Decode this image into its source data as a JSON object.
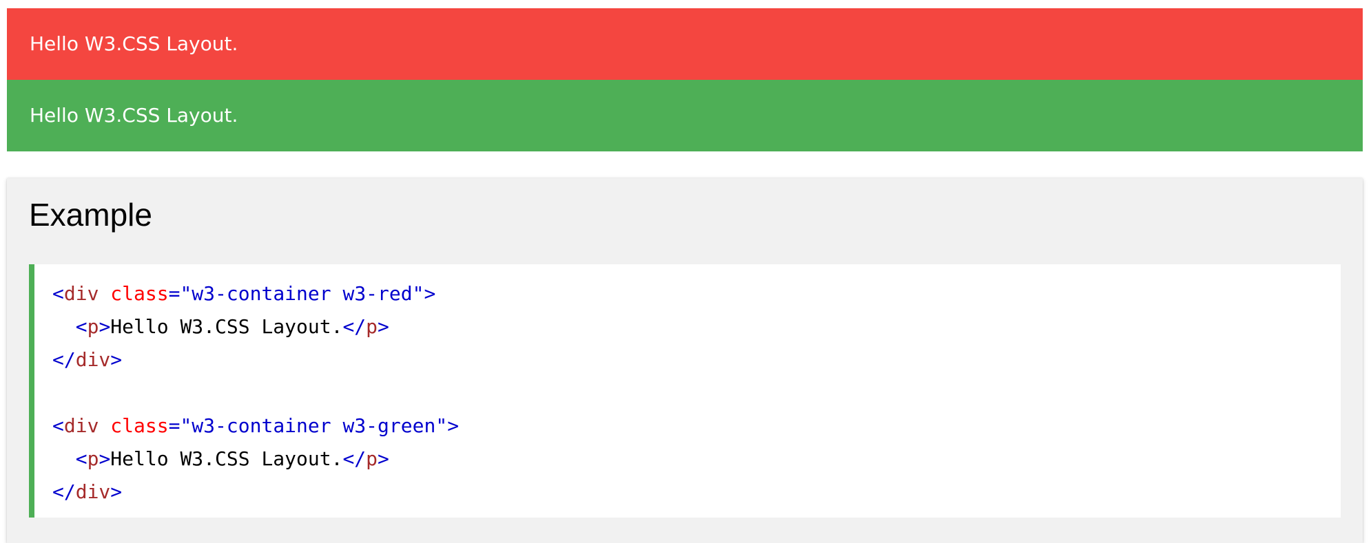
{
  "banners": {
    "red_text": "Hello W3.CSS Layout.",
    "green_text": "Hello W3.CSS Layout.",
    "red_color": "#f44640",
    "green_color": "#4eaf56"
  },
  "example": {
    "title": "Example",
    "code": {
      "line1": {
        "open": "<",
        "tag": "div",
        "space": " ",
        "attr": "class",
        "eq": "=",
        "value": "\"w3-container w3-red\"",
        "close": ">"
      },
      "line2": {
        "indent": "  ",
        "open": "<",
        "tag": "p",
        "close": ">",
        "text": "Hello W3.CSS Layout.",
        "end_open": "</",
        "end_tag": "p",
        "end_close": ">"
      },
      "line3": {
        "open": "</",
        "tag": "div",
        "close": ">"
      },
      "line5": {
        "open": "<",
        "tag": "div",
        "space": " ",
        "attr": "class",
        "eq": "=",
        "value": "\"w3-container w3-green\"",
        "close": ">"
      },
      "line6": {
        "indent": "  ",
        "open": "<",
        "tag": "p",
        "close": ">",
        "text": "Hello W3.CSS Layout.",
        "end_open": "</",
        "end_tag": "p",
        "end_close": ">"
      },
      "line7": {
        "open": "</",
        "tag": "div",
        "close": ">"
      }
    }
  }
}
